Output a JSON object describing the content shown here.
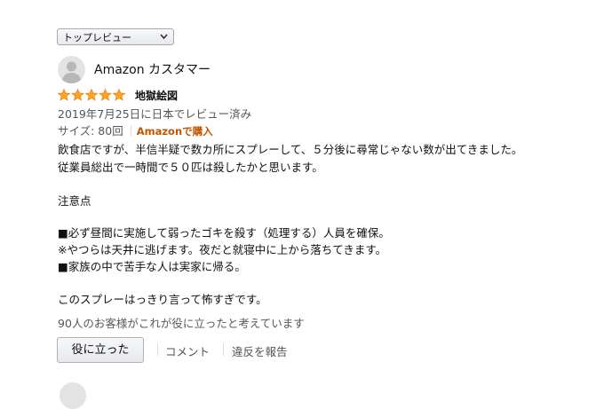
{
  "sort": {
    "selected": "トップレビュー"
  },
  "review": {
    "reviewer": "Amazon カスタマー",
    "rating": 5,
    "title": "地獄絵図",
    "date": "2019年7月25日に日本でレビュー済み",
    "variant": "サイズ: 80回",
    "purchase_badge": "Amazonで購入",
    "body": [
      "飲食店ですが、半信半疑で数カ所にスプレーして、５分後に尋常じゃない数が出てきました。",
      "従業員総出で一時間で５０匹は殺したかと思います。",
      "",
      "注意点",
      "",
      "■必ず昼間に実施して弱ったゴキを殺す（処理する）人員を確保。",
      "※やつらは天井に逃げます。夜だと就寝中に上から落ちてきます。",
      "■家族の中で苦手な人は実家に帰る。",
      "",
      "このスプレーはっきり言って怖すぎです。"
    ],
    "helpful_count": "90人のお客様がこれが役に立ったと考えています",
    "actions": {
      "helpful": "役に立った",
      "comment": "コメント",
      "report": "違反を報告"
    }
  },
  "colors": {
    "star": "#ffa41c",
    "badge": "#c45500",
    "muted": "#555555"
  },
  "icons": [
    "chevron-down-icon",
    "user-avatar-icon",
    "star-icon"
  ]
}
